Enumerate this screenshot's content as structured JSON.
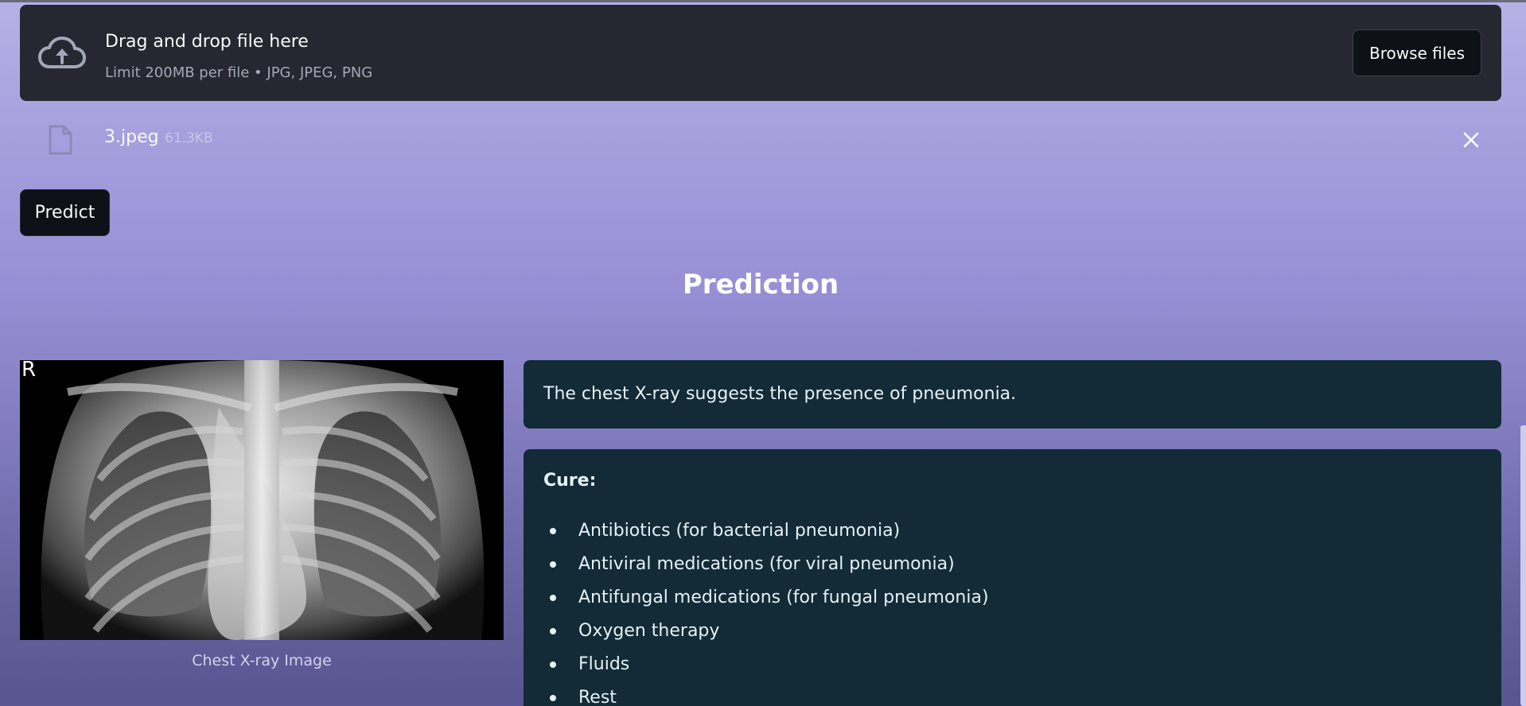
{
  "uploader": {
    "icon": "cloud-upload-icon",
    "title": "Drag and drop file here",
    "subtitle": "Limit 200MB per file • JPG, JPEG, PNG",
    "browse_label": "Browse files"
  },
  "file": {
    "icon": "file-icon",
    "name": "3.jpeg",
    "size": "61.3KB",
    "remove_icon": "close-icon"
  },
  "predict_label": "Predict",
  "prediction": {
    "heading": "Prediction",
    "image_caption": "Chest X-ray Image",
    "image_marker": "R",
    "result_text": "The chest X-ray suggests the presence of pneumonia.",
    "cure_title": "Cure:",
    "cure_items": [
      "Antibiotics (for bacterial pneumonia)",
      "Antiviral medications (for viral pneumonia)",
      "Antifungal medications (for fungal pneumonia)",
      "Oxygen therapy",
      "Fluids",
      "Rest"
    ]
  },
  "colors": {
    "panel_dark": "#262730",
    "button_dark": "#0e1117",
    "info_box": "#132a37",
    "bg_top": "#b7b1e6",
    "bg_bottom": "#575591"
  }
}
